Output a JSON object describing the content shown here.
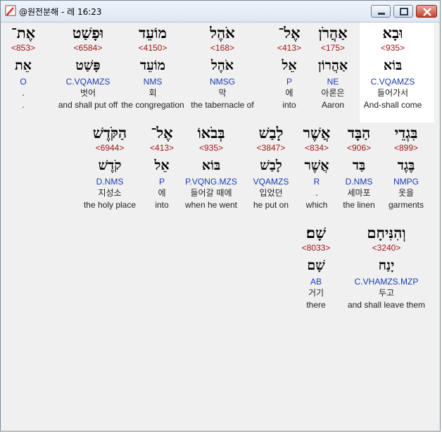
{
  "window": {
    "title": "@원전분해 - 레 16:23"
  },
  "rows": [
    [
      {
        "heb": "וּבָא",
        "strong": "<935>",
        "lemma": "בּוֹא",
        "morph": "C.VQAMZS",
        "kor": "들어가서",
        "eng": "And-shall come"
      },
      {
        "heb": "אַהֲרֹן",
        "strong": "<175>",
        "lemma": "אַהֲרוֹן",
        "morph": "NE",
        "kor": "아론은",
        "eng": "Aaron"
      },
      {
        "heb": "אֶל־",
        "strong": "<413>",
        "lemma": "אֵל",
        "morph": "P",
        "kor": "에",
        "eng": "into"
      },
      {
        "heb": "אֹהֶל",
        "strong": "<168>",
        "lemma": "אֹהֶל",
        "morph": "NMSG",
        "kor": "막",
        "eng": "the tabernacle of"
      },
      {
        "heb": "מוֹעֵד",
        "strong": "<4150>",
        "lemma": "מוֹעֵד",
        "morph": "NMS",
        "kor": "회",
        "eng": "the congregation"
      },
      {
        "heb": "וּפָשַׁט",
        "strong": "<6584>",
        "lemma": "פָּשַׁט",
        "morph": "C.VQAMZS",
        "kor": "벗어",
        "eng": "and shall put off"
      },
      {
        "heb": "אֶת־",
        "strong": "<853>",
        "lemma": "אֵת",
        "morph": "O",
        "kor": ".",
        "eng": "."
      }
    ],
    [
      {
        "heb": "בִּגְדֵי",
        "strong": "<899>",
        "lemma": "בֶּגֶד",
        "morph": "NMPG",
        "kor": "옷을",
        "eng": "garments"
      },
      {
        "heb": "הַבָּד",
        "strong": "<906>",
        "lemma": "בַּד",
        "morph": "D.NMS",
        "kor": "세마포",
        "eng": "the linen"
      },
      {
        "heb": "אֲשֶׁר",
        "strong": "<834>",
        "lemma": "אֲשֶׁר",
        "morph": "R",
        "kor": ".",
        "eng": "which"
      },
      {
        "heb": "לָבַשׁ",
        "strong": "<3847>",
        "lemma": "לָבַשׁ",
        "morph": "VQAMZS",
        "kor": "입었던",
        "eng": "he put on"
      },
      {
        "heb": "בְּבֹאוֹ",
        "strong": "<935>",
        "lemma": "בּוֹא",
        "morph": "P.VQNG.MZS",
        "kor": "들어갈 때에",
        "eng": "when he went"
      },
      {
        "heb": "אֶל־",
        "strong": "<413>",
        "lemma": "אֵל",
        "morph": "P",
        "kor": "에",
        "eng": "into"
      },
      {
        "heb": "הַקֹּדֶשׁ",
        "strong": "<6944>",
        "lemma": "קֹדֶשׁ",
        "morph": "D.NMS",
        "kor": "지성소",
        "eng": "the holy place"
      }
    ],
    [
      {
        "heb": "וְהִנִּיחָם",
        "strong": "<3240>",
        "lemma": "יָנַח",
        "morph": "C.VHAMZS.MZP",
        "kor": "두고",
        "eng": "and shall leave them"
      },
      {
        "heb": "שָׁם׃",
        "strong": "<8033>",
        "lemma": "שָׁם",
        "morph": "AB",
        "kor": "거기",
        "eng": "there"
      }
    ]
  ]
}
